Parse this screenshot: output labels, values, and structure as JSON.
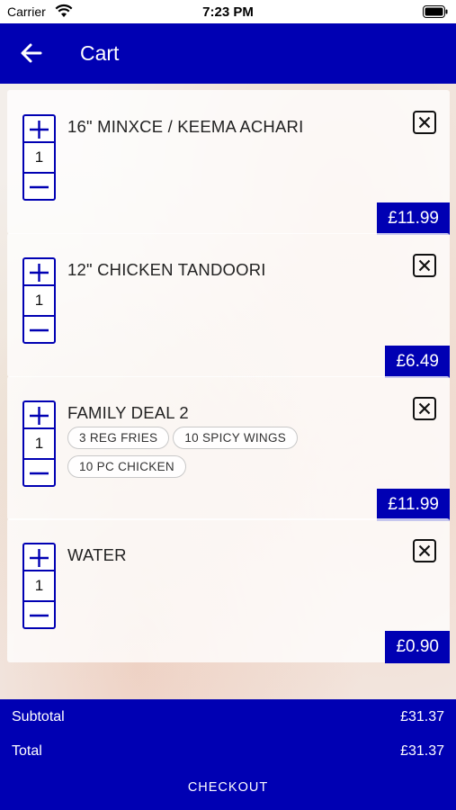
{
  "status_bar": {
    "carrier": "Carrier",
    "time": "7:23 PM",
    "wifi_icon": "wifi-icon",
    "battery_icon": "battery-icon"
  },
  "header": {
    "title": "Cart",
    "back_icon": "arrow-left-icon",
    "background_color": "#0000b3"
  },
  "cart": {
    "items": [
      {
        "name": "16\" MINXCE / KEEMA ACHARI",
        "quantity": "1",
        "price": "£11.99",
        "options": []
      },
      {
        "name": "12\" CHICKEN TANDOORI",
        "quantity": "1",
        "price": "£6.49",
        "options": []
      },
      {
        "name": "FAMILY DEAL 2",
        "quantity": "1",
        "price": "£11.99",
        "options": [
          "3 REG FRIES",
          "10 SPICY WINGS",
          "10 PC CHICKEN"
        ]
      },
      {
        "name": "WATER",
        "quantity": "1",
        "price": "£0.90",
        "options": []
      }
    ],
    "icons": {
      "increment": "plus-icon",
      "decrement": "minus-icon",
      "remove": "close-box-icon"
    }
  },
  "summary": {
    "subtotal_label": "Subtotal",
    "subtotal_value": "£31.37",
    "total_label": "Total",
    "total_value": "£31.37",
    "checkout_label": "CHECKOUT"
  },
  "colors": {
    "accent": "#0000b3",
    "text": "#222222"
  }
}
